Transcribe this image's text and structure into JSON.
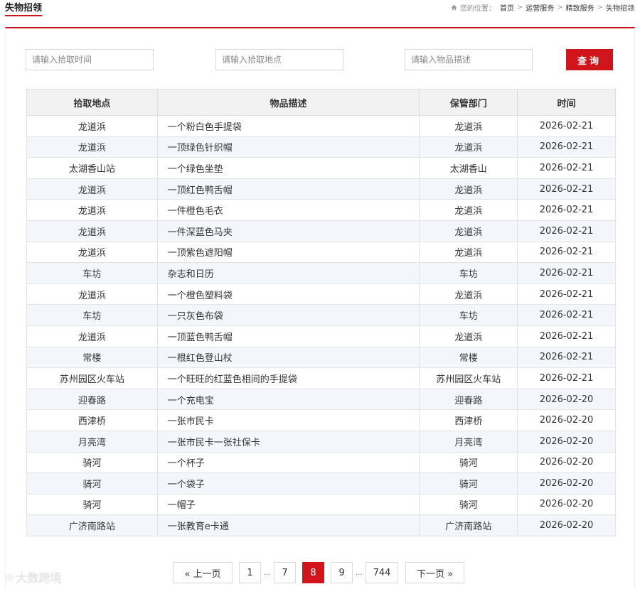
{
  "header": {
    "title": "失物招领",
    "breadcrumb_prefix": "您的位置：",
    "breadcrumb": [
      "首页",
      "运营服务",
      "精致服务",
      "失物招领"
    ],
    "separator": ">"
  },
  "filters": {
    "time_placeholder": "请输入拾取时间",
    "place_placeholder": "请输入拾取地点",
    "desc_placeholder": "请输入物品描述",
    "query_label": "查询"
  },
  "table": {
    "columns": [
      "拾取地点",
      "物品描述",
      "保管部门",
      "时间"
    ],
    "rows": [
      [
        "龙道浜",
        "一个粉白色手提袋",
        "龙道浜",
        "2026-02-21"
      ],
      [
        "龙道浜",
        "一顶绿色针织帽",
        "龙道浜",
        "2026-02-21"
      ],
      [
        "太湖香山站",
        "一个绿色坐垫",
        "太湖香山",
        "2026-02-21"
      ],
      [
        "龙道浜",
        "一顶红色鸭舌帽",
        "龙道浜",
        "2026-02-21"
      ],
      [
        "龙道浜",
        "一件橙色毛衣",
        "龙道浜",
        "2026-02-21"
      ],
      [
        "龙道浜",
        "一件深蓝色马夹",
        "龙道浜",
        "2026-02-21"
      ],
      [
        "龙道浜",
        "一顶紫色遮阳帽",
        "龙道浜",
        "2026-02-21"
      ],
      [
        "车坊",
        "杂志和日历",
        "车坊",
        "2026-02-21"
      ],
      [
        "龙道浜",
        "一个橙色塑料袋",
        "龙道浜",
        "2026-02-21"
      ],
      [
        "车坊",
        "一只灰色布袋",
        "车坊",
        "2026-02-21"
      ],
      [
        "龙道浜",
        "一顶蓝色鸭舌帽",
        "龙道浜",
        "2026-02-21"
      ],
      [
        "常楼",
        "一根红色登山杖",
        "常楼",
        "2026-02-21"
      ],
      [
        "苏州园区火车站",
        "一个旺旺的红蓝色相间的手提袋",
        "苏州园区火车站",
        "2026-02-21"
      ],
      [
        "迎春路",
        "一个充电宝",
        "迎春路",
        "2026-02-20"
      ],
      [
        "西津桥",
        "一张市民卡",
        "西津桥",
        "2026-02-20"
      ],
      [
        "月亮湾",
        "一张市民卡一张社保卡",
        "月亮湾",
        "2026-02-20"
      ],
      [
        "骑河",
        "一个杯子",
        "骑河",
        "2026-02-20"
      ],
      [
        "骑河",
        "一个袋子",
        "骑河",
        "2026-02-20"
      ],
      [
        "骑河",
        "一帽子",
        "骑河",
        "2026-02-20"
      ],
      [
        "广济南路站",
        "一张教育e卡通",
        "广济南路站",
        "2026-02-20"
      ]
    ]
  },
  "pagination": {
    "prev_label": "« 上一页",
    "next_label": "下一页 »",
    "pages": [
      "1",
      "7",
      "8",
      "9",
      "744"
    ],
    "ellipsis": "...",
    "current": "8"
  },
  "watermark": {
    "text": "大数跨境"
  },
  "colors": {
    "accent": "#d2141b",
    "header_bg": "#f2f2f2",
    "row_alt": "#f3f6fb"
  }
}
